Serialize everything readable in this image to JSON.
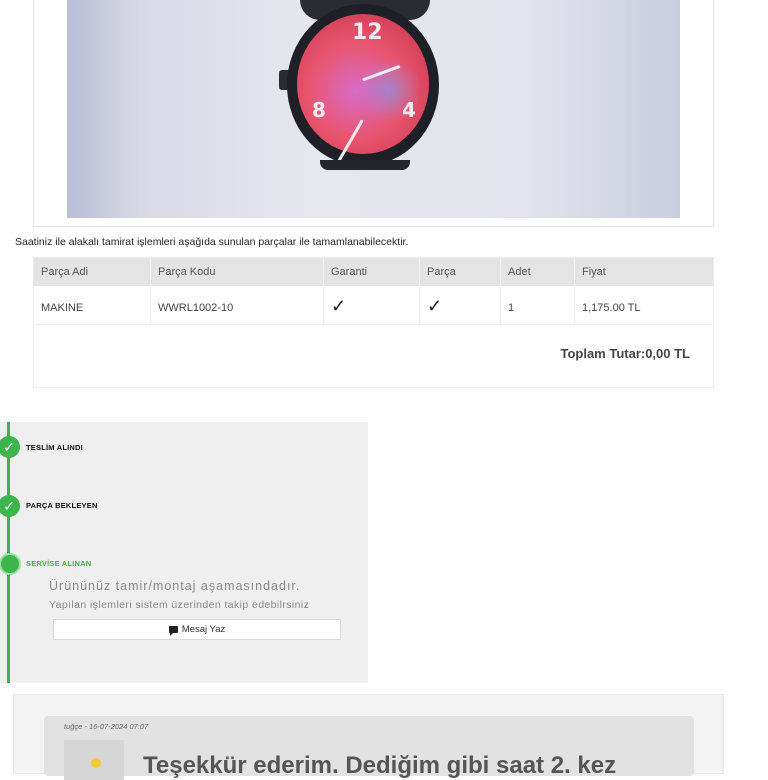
{
  "photo": {
    "alt_icon": "watch-photo"
  },
  "intro_text": "Saatiniz ile alakalı tamirat işlemleri aşağıda sunulan parçalar ile tamamlanabilecektir.",
  "table": {
    "headers": [
      "Parça Adi",
      "Parça Kodu",
      "Garanti",
      "Parça",
      "Adet",
      "Fiyat"
    ],
    "rows": [
      {
        "name": "MAKINE",
        "code": "WWRL1002-10",
        "warranty_icon": "check-icon",
        "part_icon": "check-icon",
        "qty": "1",
        "price": "1,175.00 TL"
      }
    ],
    "check_glyph": "✓",
    "total": "Toplam Tutar:0,00 TL"
  },
  "status": {
    "accent": "#3cb54a",
    "steps": [
      {
        "label": "TESLİM ALINDI",
        "state": "done"
      },
      {
        "label": "PARÇA BEKLEYEN",
        "state": "done"
      },
      {
        "label": "SERVİSE ALINAN",
        "state": "active"
      }
    ],
    "message": "Ürününüz tamir/montaj aşamasındadır.",
    "sub_message": "Yapılan işlemleri sistem üzerinden takip edebilrsiniz",
    "button_label": "Mesaj Yaz",
    "check_glyph": "✓"
  },
  "comment": {
    "meta": "tuğçe - 16-07-2024 07:07",
    "text": "Teşekkür ederim. Dediğim gibi saat 2. kez"
  }
}
